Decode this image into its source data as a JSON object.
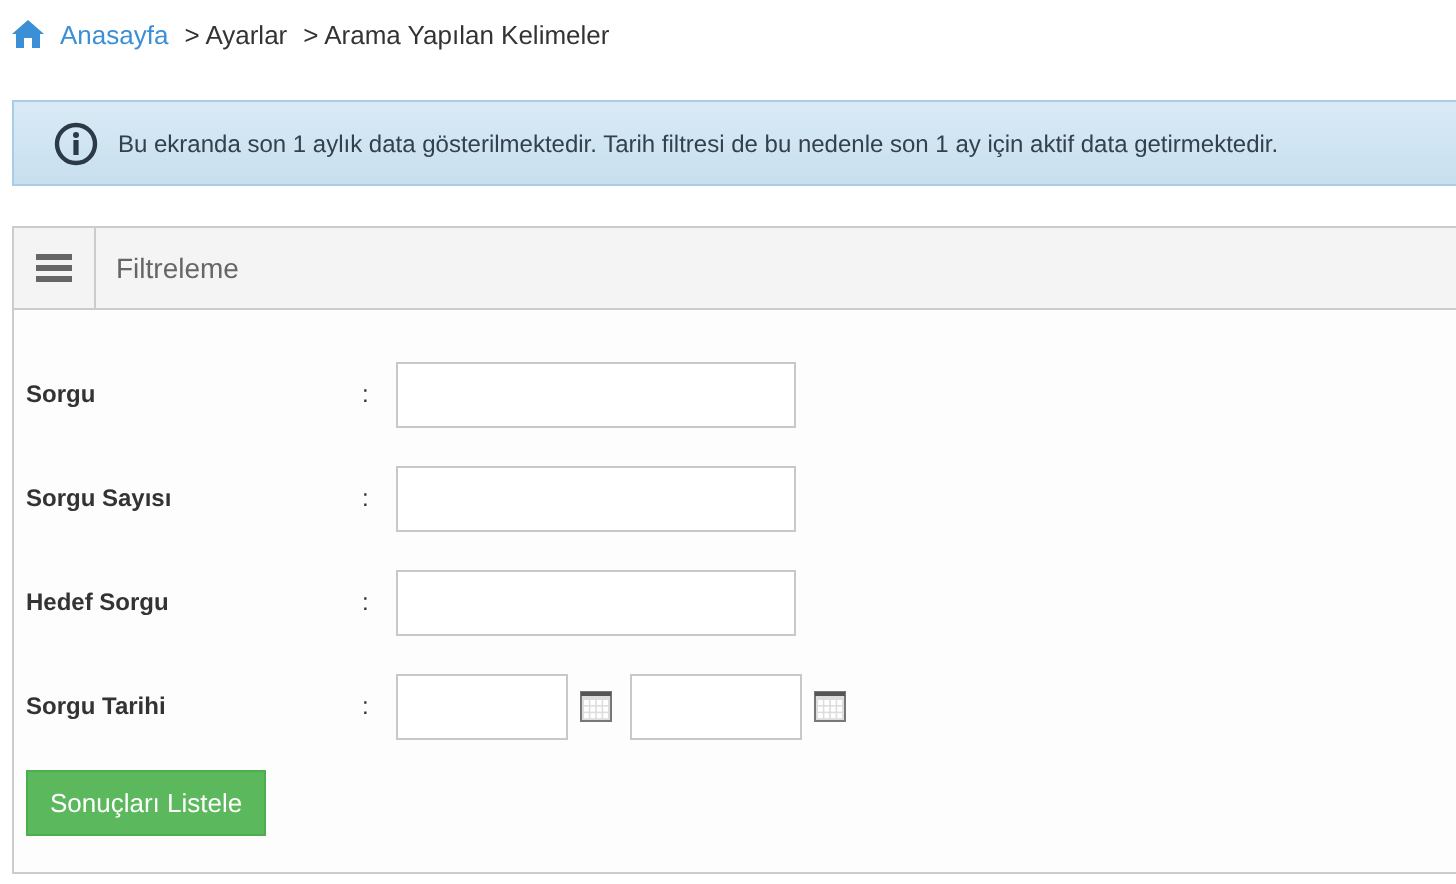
{
  "breadcrumb": [
    {
      "label": "Anasayfa",
      "kind": "link"
    },
    {
      "label": "> Ayarlar",
      "kind": "text"
    },
    {
      "label": "> Arama Yapılan Kelimeler",
      "kind": "text"
    }
  ],
  "info": {
    "text": "Bu ekranda son 1 aylık data gösterilmektedir. Tarih filtresi de bu nedenle son 1 ay için aktif data getirmektedir."
  },
  "panel": {
    "title": "Filtreleme",
    "fields": [
      {
        "label": "Sorgu",
        "separator": ":",
        "kind": "text"
      },
      {
        "label": "Sorgu Sayısı",
        "separator": ":",
        "kind": "text"
      },
      {
        "label": "Hedef Sorgu",
        "separator": ":",
        "kind": "text"
      },
      {
        "label": "Sorgu Tarihi",
        "separator": ":",
        "kind": "date_range"
      }
    ],
    "button": "Sonuçları Listele"
  }
}
